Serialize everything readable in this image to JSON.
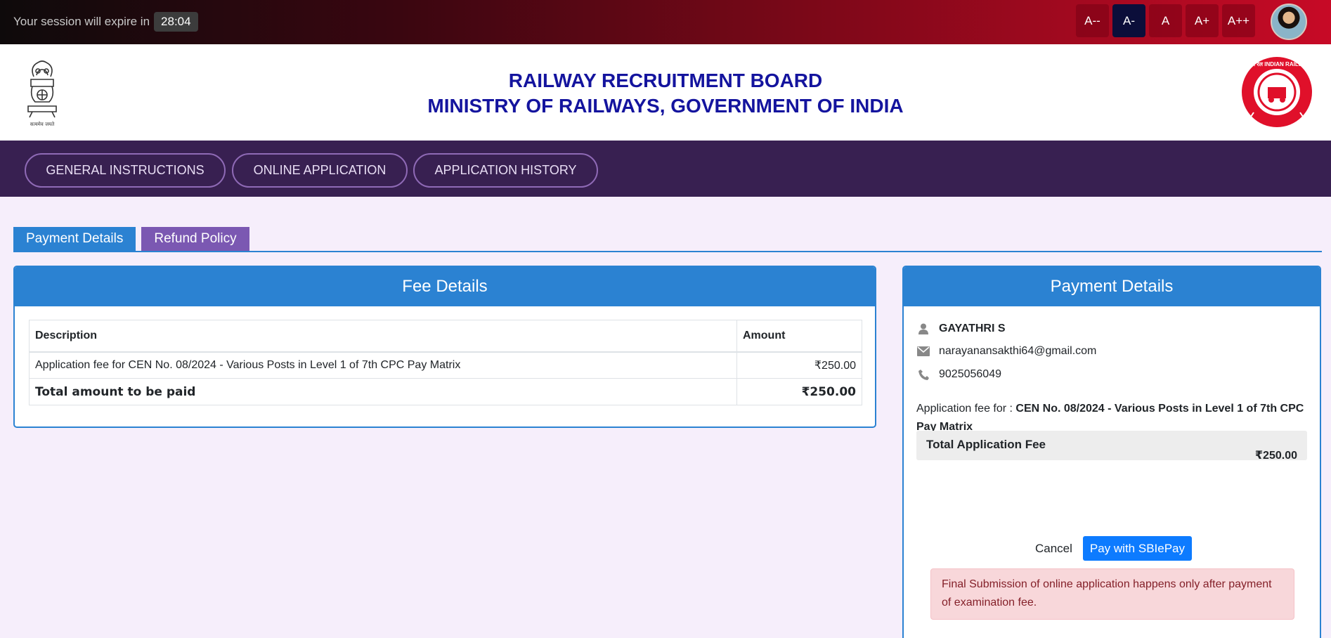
{
  "session": {
    "label": "Your session will expire in",
    "timer": "28:04"
  },
  "font_controls": [
    "A--",
    "A-",
    "A",
    "A+",
    "A++"
  ],
  "font_controls_active": "A-",
  "header": {
    "title_line1": "RAILWAY RECRUITMENT BOARD",
    "title_line2": "MINISTRY OF RAILWAYS, GOVERNMENT OF INDIA",
    "emblem_caption": "सत्यमेव जयते",
    "right_logo_text": "भारतीय रेल INDIAN RAILWAYS"
  },
  "nav": {
    "general": "GENERAL INSTRUCTIONS",
    "online": "ONLINE APPLICATION",
    "history": "APPLICATION HISTORY"
  },
  "tabs": {
    "payment": "Payment Details",
    "refund": "Refund Policy"
  },
  "fee_details": {
    "title": "Fee Details",
    "col_description": "Description",
    "col_amount": "Amount",
    "row_description": "Application fee for CEN No. 08/2024 - Various Posts in Level 1 of 7th CPC Pay Matrix",
    "row_amount": "₹250.00",
    "total_label": "Total amount to be paid",
    "total_amount": "₹250.00"
  },
  "payment_details": {
    "title": "Payment Details",
    "name": "GAYATHRI S",
    "email": "narayanansakthi64@gmail.com",
    "phone": "9025056049",
    "fee_for_label": "Application fee for :",
    "fee_for_value": "CEN No. 08/2024 - Various Posts in Level 1 of 7th CPC Pay Matrix",
    "total_label": "Total Application Fee",
    "total_value": "₹250.00",
    "cancel": "Cancel",
    "pay_button": "Pay with SBIePay",
    "notice": "Final Submission of online application happens only after payment of examination fee."
  },
  "colors": {
    "accent": "#2b82d2",
    "nav": "#382051",
    "tab_secondary": "#7b58b2",
    "title": "#14149e"
  },
  "icons": [
    "user-icon",
    "envelope-icon",
    "phone-icon"
  ]
}
